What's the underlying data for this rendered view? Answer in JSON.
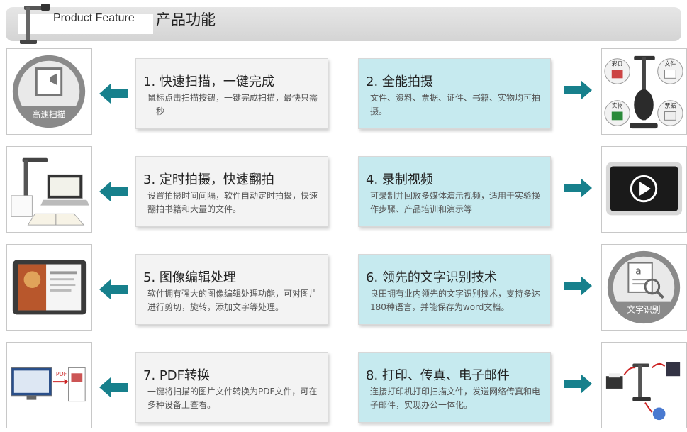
{
  "header": {
    "title_en": "Product Feature",
    "title_zh": "产品功能",
    "logo_icon": "document-camera-icon"
  },
  "colors": {
    "accent_arrow": "#17808c",
    "right_card_bg": "#c6eaef",
    "left_card_bg": "#f3f3f3"
  },
  "features": [
    {
      "title": "1. 快速扫描，一键完成",
      "desc": "鼠标点击扫描按钮，一键完成扫描，最快只需一秒",
      "image_label": "高速扫描"
    },
    {
      "title": "2. 全能拍摄",
      "desc": "文件、资料、票据、证件、书籍、实物均可拍摄。",
      "image_labels": [
        "彩页",
        "文件",
        "实物",
        "票据"
      ]
    },
    {
      "title": "3. 定时拍摄，快速翻拍",
      "desc": "设置拍摄时间间隔，软件自动定时拍摄，快速翻拍书籍和大量的文件。"
    },
    {
      "title": "4. 录制视频",
      "desc": "可录制并回放多媒体演示视频，适用于实验操作步骤、产品培训和演示等"
    },
    {
      "title": "5. 图像编辑处理",
      "desc": "软件拥有强大的图像编辑处理功能，可对图片进行剪切，旋转，添加文字等处理。"
    },
    {
      "title": "6. 领先的文字识别技术",
      "desc": "良田拥有业内领先的文字识别技术，支持多达180种语言，并能保存为word文档。",
      "image_label": "文字识别"
    },
    {
      "title": "7. PDF转换",
      "desc": "一键将扫描的图片文件转换为PDF文件，可在多种设备上查看。",
      "image_label": "PDF"
    },
    {
      "title": "8. 打印、传真、电子邮件",
      "desc": "连接打印机打印扫描文件，发送网络传真和电子邮件，实现办公一体化。"
    }
  ]
}
